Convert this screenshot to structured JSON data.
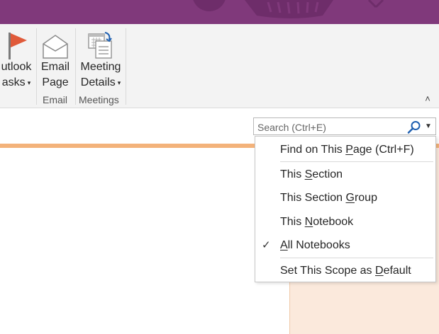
{
  "ribbon": {
    "buttons": [
      {
        "line1": "utlook",
        "line2": "asks",
        "has_caret": true,
        "icon": "flag-icon"
      },
      {
        "line1": "Email",
        "line2": "Page",
        "has_caret": false,
        "icon": "envelope-icon"
      },
      {
        "line1": "Meeting",
        "line2": "Details",
        "has_caret": true,
        "icon": "calendar-icon"
      }
    ],
    "groups": [
      "Email",
      "Meetings"
    ],
    "caret": "▾",
    "collapse_glyph": "˄"
  },
  "search": {
    "placeholder": "Search (Ctrl+E)",
    "scope_caret": "▼"
  },
  "menu": {
    "items": [
      {
        "pre": "Find on This ",
        "key": "P",
        "post": "age (Ctrl+F)",
        "checked": false
      },
      {
        "pre": "This ",
        "key": "S",
        "post": "ection",
        "checked": false
      },
      {
        "pre": "This Section ",
        "key": "G",
        "post": "roup",
        "checked": false
      },
      {
        "pre": "This ",
        "key": "N",
        "post": "otebook",
        "checked": false
      },
      {
        "pre": "",
        "key": "A",
        "post": "ll Notebooks",
        "checked": true
      },
      {
        "pre": "Set This Scope as ",
        "key": "D",
        "post": "efault",
        "checked": false
      }
    ],
    "check_glyph": "✓"
  },
  "colors": {
    "titlebar": "#80397b",
    "ribbon": "#f3f3f3",
    "page_line": "#f3b27a",
    "side_panel": "#fbe9dc",
    "flag": "#e05a3a",
    "search_icon": "#1e5fb0"
  }
}
